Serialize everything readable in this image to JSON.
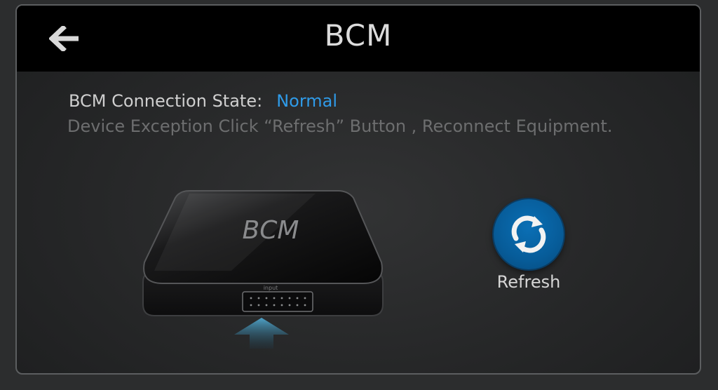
{
  "header": {
    "title": "BCM",
    "back_icon": "back-arrow-icon"
  },
  "status": {
    "label": "BCM Connection State:",
    "value": "Normal",
    "value_color": "#2f9be8"
  },
  "hint": "Device Exception Click  “Refresh”  Button , Reconnect Equipment.",
  "device": {
    "logo": "BCM",
    "port_label": "input"
  },
  "refresh": {
    "label": "Refresh",
    "icon": "refresh-icon",
    "color": "#0a6fb5"
  }
}
